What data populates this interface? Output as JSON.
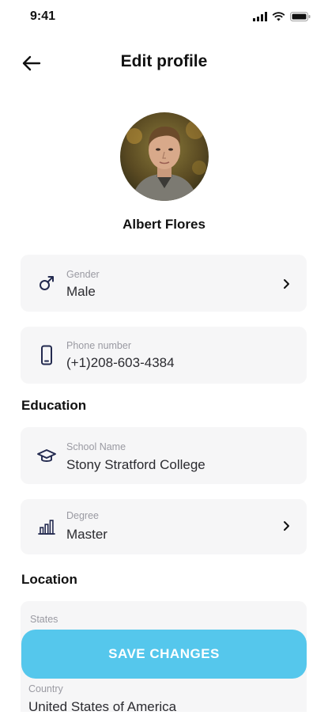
{
  "status_bar": {
    "time": "9:41",
    "icons": [
      "cellular-signal-icon",
      "wifi-icon",
      "battery-icon"
    ]
  },
  "header": {
    "title": "Edit profile",
    "back_icon": "arrow-left-icon"
  },
  "profile": {
    "name": "Albert Flores",
    "avatar_icon": "profile-photo"
  },
  "fields": {
    "gender": {
      "label": "Gender",
      "value": "Male",
      "icon": "male-symbol-icon"
    },
    "phone": {
      "label": "Phone number",
      "value": "(+1)208-603-4384",
      "icon": "smartphone-icon"
    }
  },
  "education": {
    "title": "Education",
    "school": {
      "label": "School Name",
      "value": "Stony Stratford College",
      "icon": "graduation-cap-icon"
    },
    "degree": {
      "label": "Degree",
      "value": "Master",
      "icon": "bar-chart-icon"
    }
  },
  "location": {
    "title": "Location",
    "states": {
      "label": "States",
      "value": ""
    },
    "country": {
      "label": "Country",
      "value": "United States of America"
    }
  },
  "actions": {
    "save_label": "SAVE CHANGES"
  },
  "colors": {
    "accent": "#55c7ec",
    "field_bg": "#f6f6f7",
    "label_gray": "#9a9aa2",
    "icon_navy": "#232a4f"
  }
}
